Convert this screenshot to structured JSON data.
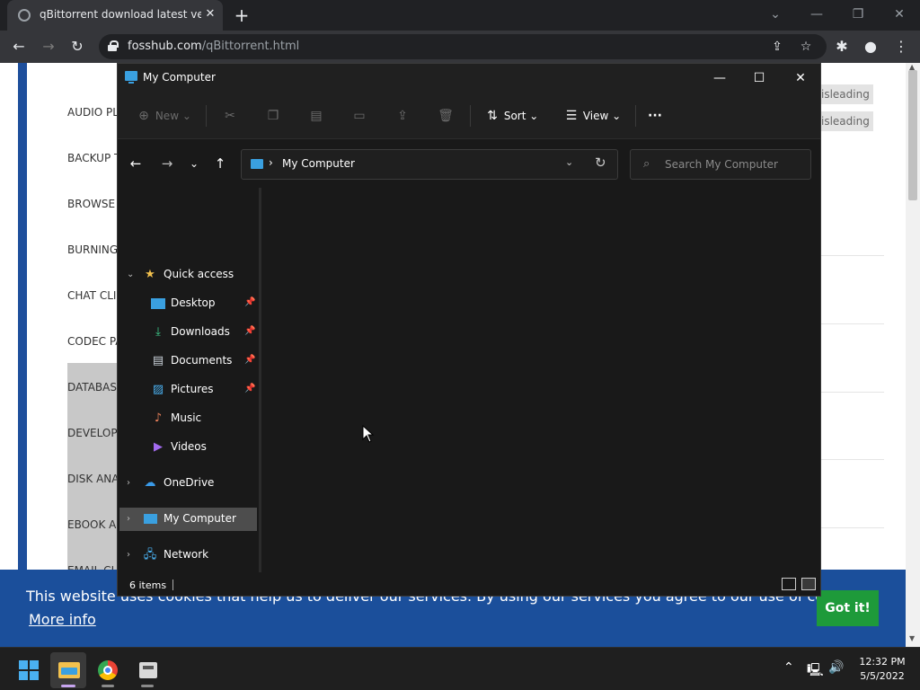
{
  "browser": {
    "tab_title": "qBittorrent download latest version",
    "tab_close": "✕",
    "new_tab": "+",
    "url_host": "fosshub.com",
    "url_path": "/qBittorrent.html"
  },
  "webpage": {
    "categories": [
      "AUDIO PL",
      "BACKUP T",
      "BROWSE",
      "BURNING",
      "CHAT CLI",
      "CODEC PA",
      "DATABAS",
      "DEVELOP",
      "DISK ANA",
      "EBOOK A",
      "EMAIL CL"
    ],
    "badges": [
      "isleading",
      "isleading"
    ],
    "cookie_text": "This website uses cookies that help us to deliver our services. By using our services you agree to our use of cookies.",
    "cookie_more": "More info",
    "cookie_button": "Got it!"
  },
  "explorer": {
    "title": "My Computer",
    "commands": {
      "new": "New",
      "sort": "Sort",
      "view": "View",
      "more": "···"
    },
    "address": "My Computer",
    "search_placeholder": "Search My Computer",
    "tree": {
      "quick_access": "Quick access",
      "desktop": "Desktop",
      "downloads": "Downloads",
      "documents": "Documents",
      "pictures": "Pictures",
      "music": "Music",
      "videos": "Videos",
      "onedrive": "OneDrive",
      "my_computer": "My Computer",
      "network": "Network"
    },
    "status": "6 items"
  },
  "taskbar": {
    "time": "12:32 PM",
    "date": "5/5/2022"
  },
  "colors": {
    "browser_bg": "#202124",
    "explorer_bg": "#191919",
    "cookie_banner": "#1b4f9b",
    "cookie_button": "#1e9a3a",
    "selection": "#4d4d4d"
  }
}
